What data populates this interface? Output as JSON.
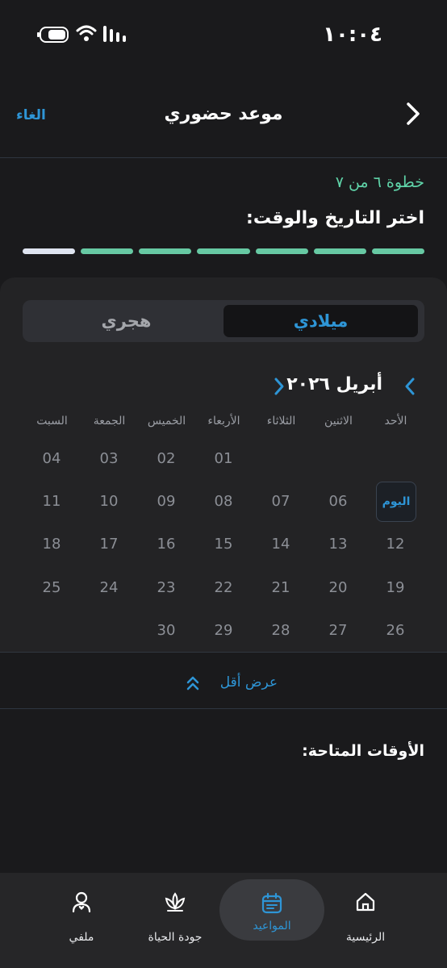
{
  "status_bar": {
    "time": "١٠:٠٤"
  },
  "header": {
    "title": "موعد حضوري",
    "cancel_label": "الغاء"
  },
  "step": {
    "text": "خطوة ٦ من ٧",
    "heading": "اختر التاريخ والوقت:",
    "current": 6,
    "total": 7
  },
  "calendar": {
    "toggle": {
      "gregorian": "ميلادي",
      "hijri": "هجري",
      "selected": "gregorian"
    },
    "month_label": "أبريل ٢٠٢٦",
    "weekdays": [
      "الأحد",
      "الاثنين",
      "الثلاثاء",
      "الأربعاء",
      "الخميس",
      "الجمعة",
      "السبت"
    ],
    "weeks": [
      [
        "",
        "",
        "",
        "01",
        "02",
        "03",
        "04"
      ],
      [
        "اليوم",
        "06",
        "07",
        "08",
        "09",
        "10",
        "11"
      ],
      [
        "12",
        "13",
        "14",
        "15",
        "16",
        "17",
        "18"
      ],
      [
        "19",
        "20",
        "21",
        "22",
        "23",
        "24",
        "25"
      ],
      [
        "26",
        "27",
        "28",
        "29",
        "30",
        "",
        ""
      ]
    ],
    "show_less_label": "عرض أقل"
  },
  "available_times_heading": "الأوقات المتاحة:",
  "bottom_nav": {
    "home": "الرئيسية",
    "appointments": "المواعيد",
    "quality_of_life": "جودة الحياة",
    "profile": "ملفي",
    "active": "appointments"
  },
  "colors": {
    "accent": "#2e95d6",
    "step_green": "#5fd3a8",
    "progress_done": "#67c9a3",
    "background": "#1a1a1c"
  }
}
